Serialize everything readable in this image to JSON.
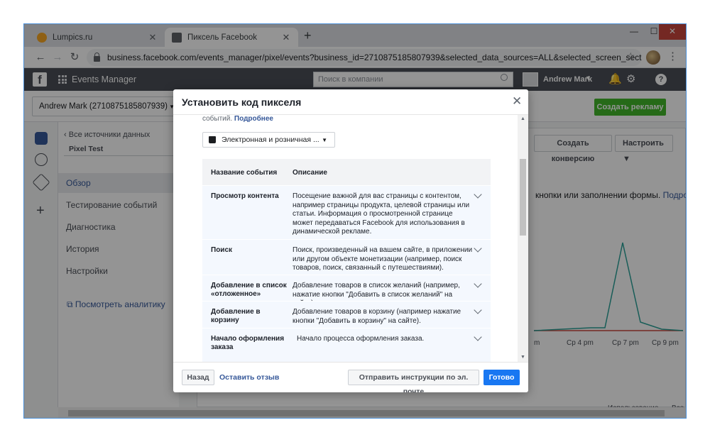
{
  "browser": {
    "tabs": [
      {
        "title": "Lumpics.ru",
        "favicon_color": "#f6a623"
      },
      {
        "title": "Пиксель Facebook",
        "favicon_color": "#5f6368"
      }
    ],
    "url": "business.facebook.com/events_manager/pixel/events?business_id=2710875185807939&selected_data_sources=ALL&selected_screen_section=DAT..."
  },
  "fb_header": {
    "logo": "f",
    "app_title": "Events Manager",
    "search_placeholder": "Поиск в компании",
    "account_name": "Andrew Mark"
  },
  "subheader": {
    "account_select": "Andrew Mark (2710875185807939)",
    "create_ad": "Создать рекламу"
  },
  "nav": {
    "all_sources": "Все источники данных",
    "pixel": "Pixel Test",
    "items": [
      {
        "label": "Обзор",
        "active": true
      },
      {
        "label": "Тестирование событий",
        "active": false
      },
      {
        "label": "Диагностика",
        "active": false
      },
      {
        "label": "История",
        "active": false
      },
      {
        "label": "Настройки",
        "active": false
      }
    ],
    "analytics_link": "Посмотреть аналитику"
  },
  "background": {
    "create_conversion": "Создать конверсию",
    "configure": "Настроить",
    "text": "кнопки или заполнении формы.",
    "text_link": "Подробн",
    "x_ticks": [
      "m",
      "Ср 4 pm",
      "Ср 7 pm",
      "Ср 9 pm"
    ],
    "events_usage": "Использование событий",
    "events_usage_right": "Все соб"
  },
  "modal": {
    "title": "Установить код пикселя",
    "intro_text": "событий.",
    "intro_link": "Подробнее",
    "category": "Электронная и розничная ...",
    "table": {
      "headers": [
        "Название события",
        "Описание"
      ],
      "rows": [
        {
          "name": "Просмотр контента",
          "desc": "Посещение важной для вас страницы с контентом, например страницы продукта, целевой страницы или статьи. Информация о просмотренной странице может передаваться Facebook для использования в динамической рекламе."
        },
        {
          "name": "Поиск",
          "desc": "Поиск, произведенный на вашем сайте, в приложении или другом объекте монетизации (например, поиск товаров, поиск, связанный с путешествиями)."
        },
        {
          "name": "Добавление в список «отложенное»",
          "desc": "Добавление товаров в список желаний (например, нажатие кнопки \"Добавить в список желаний\" на сайте)."
        },
        {
          "name": "Добавление в корзину",
          "desc": "Добавление товаров в корзину (например нажатие кнопки \"Добавить в корзину\" на сайте)."
        },
        {
          "name": "Начало оформления заказа",
          "desc": "Начало процесса оформления заказа."
        }
      ]
    },
    "footer": {
      "back": "Назад",
      "feedback": "Оставить отзыв",
      "email": "Отправить инструкции по эл. почте",
      "done": "Готово"
    }
  },
  "colors": {
    "fb_bar": "#4b4f56",
    "accent_blue": "#1877f2",
    "link": "#365899",
    "green": "#42b72a"
  }
}
